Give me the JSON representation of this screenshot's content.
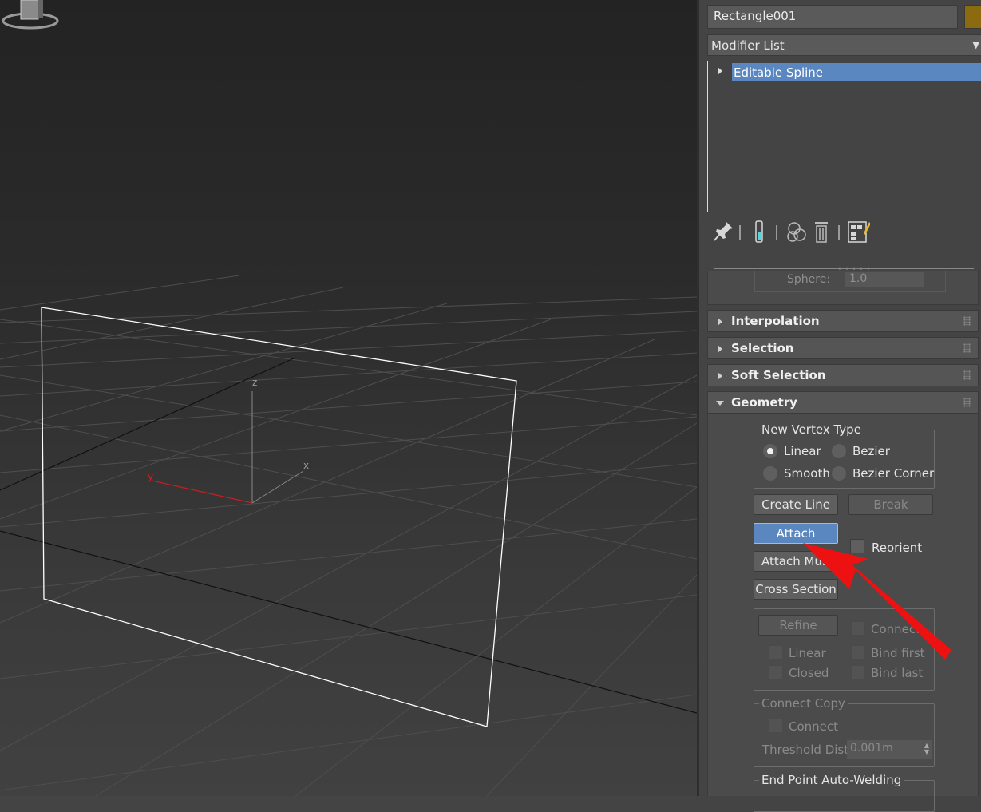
{
  "viewport": {
    "axis_labels": {
      "z": "z",
      "x": "x",
      "y": "y"
    }
  },
  "panel": {
    "object_name": "Rectangle001",
    "object_color": "#8b6a10",
    "modifier_list_label": "Modifier List",
    "stack_items": [
      "Editable Spline"
    ],
    "sphere_label": "Sphere:",
    "sphere_value": "1.0",
    "rollouts": {
      "interpolation": "Interpolation",
      "selection": "Selection",
      "soft_selection": "Soft Selection",
      "geometry": "Geometry"
    },
    "geometry": {
      "new_vertex_type_title": "New Vertex Type",
      "vertex_types": {
        "linear": "Linear",
        "bezier": "Bezier",
        "smooth": "Smooth",
        "bezier_corner": "Bezier Corner"
      },
      "selected_vertex_type": "Linear",
      "create_line": "Create Line",
      "break": "Break",
      "attach": "Attach",
      "reorient": "Reorient",
      "attach_mult": "Attach Mult.",
      "cross_section": "Cross Section",
      "refine": "Refine",
      "connect": "Connect",
      "linear": "Linear",
      "bind_first": "Bind first",
      "closed": "Closed",
      "bind_last": "Bind last",
      "connect_copy_title": "Connect Copy",
      "connect_copy_connect": "Connect",
      "threshold_label": "Threshold Dist",
      "threshold_value": "0.001m",
      "end_point_title": "End Point Auto-Welding"
    }
  },
  "colors": {
    "selection_blue": "#5b87c0",
    "annotation_arrow": "#ee1111"
  }
}
